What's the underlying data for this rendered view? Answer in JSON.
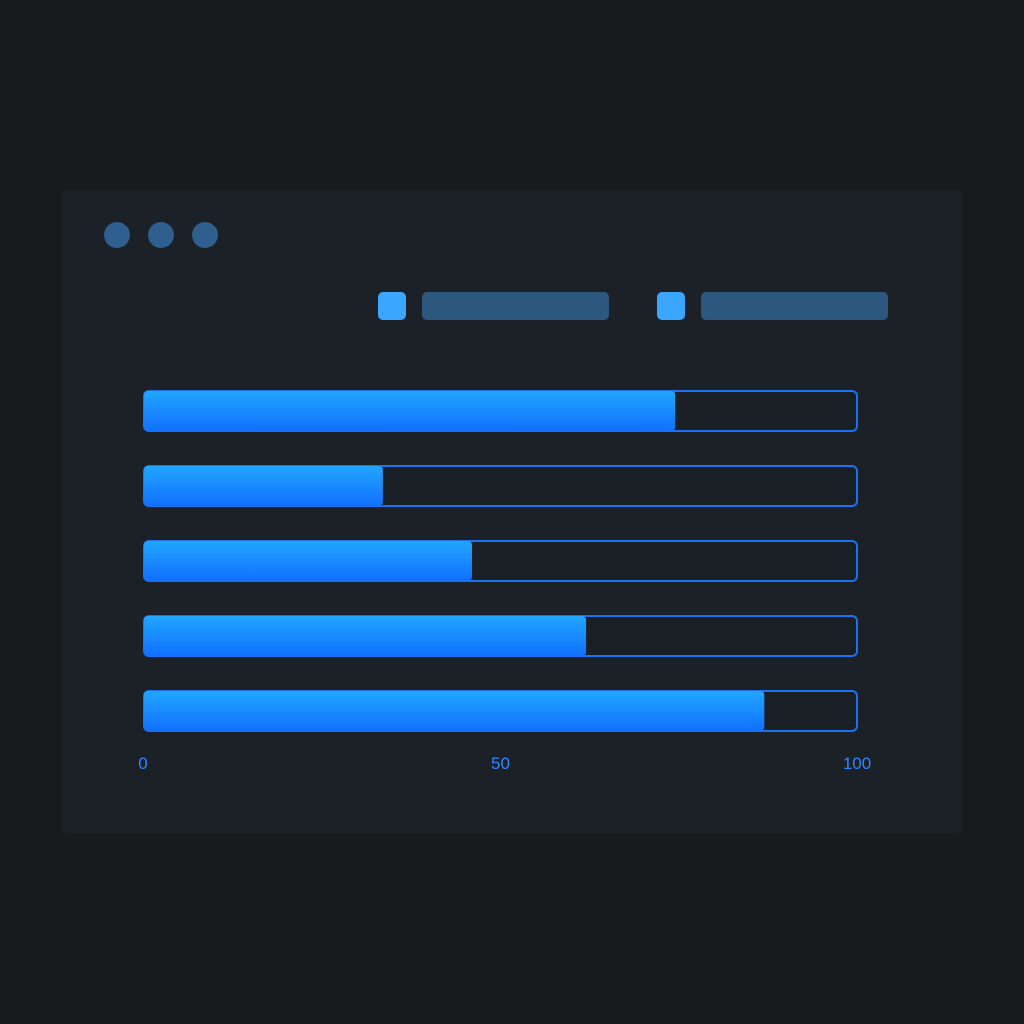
{
  "window": {
    "dots": [
      "window-dot-1",
      "window-dot-2",
      "window-dot-3"
    ]
  },
  "legend": [
    {
      "swatch_color": "#3aa6ff",
      "label_color": "#2c5880"
    },
    {
      "swatch_color": "#3aa6ff",
      "label_color": "#2c5880"
    }
  ],
  "colors": {
    "background": "#181b1e",
    "panel": "#1c2128",
    "bar_top": "#22a6ff",
    "bar_bottom": "#1170ff",
    "track_border": "#1a72f0",
    "tick_label": "#2f86ff"
  },
  "chart_data": {
    "type": "bar",
    "orientation": "horizontal",
    "categories": [
      "",
      "",
      "",
      "",
      ""
    ],
    "values": [
      74.5,
      33.5,
      46,
      62,
      87
    ],
    "xlim": [
      0,
      100
    ],
    "xticks": [
      "0",
      "50",
      "100"
    ],
    "xtick_values": [
      0,
      50,
      100
    ],
    "title": "",
    "xlabel": "",
    "ylabel": "",
    "grid": false
  }
}
